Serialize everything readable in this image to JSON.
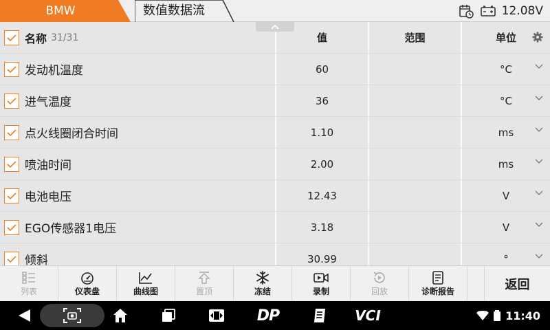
{
  "header": {
    "brand_tab": "BMW",
    "page_tab": "数值数据流",
    "voltage": "12.08V",
    "icons": [
      "calendar-clock-icon",
      "battery-icon"
    ]
  },
  "table": {
    "columns": {
      "name": "名称",
      "count": "31/31",
      "value": "值",
      "range": "范围",
      "unit": "单位"
    },
    "rows": [
      {
        "name": "发动机温度",
        "value": "60",
        "range": "",
        "unit": "°C"
      },
      {
        "name": "进气温度",
        "value": "36",
        "range": "",
        "unit": "°C"
      },
      {
        "name": "点火线圈闭合时间",
        "value": "1.10",
        "range": "",
        "unit": "ms"
      },
      {
        "name": "喷油时间",
        "value": "2.00",
        "range": "",
        "unit": "ms"
      },
      {
        "name": "电池电压",
        "value": "12.43",
        "range": "",
        "unit": "V"
      },
      {
        "name": "EGO传感器1电压",
        "value": "3.18",
        "range": "",
        "unit": "V"
      },
      {
        "name": "倾斜",
        "value": "30.99",
        "range": "",
        "unit": "°"
      }
    ]
  },
  "toolbar": {
    "list": "列表",
    "gauge": "仪表盘",
    "graph": "曲线图",
    "pin_top": "置顶",
    "freeze": "冻结",
    "record": "录制",
    "playback": "回放",
    "report": "诊断报告",
    "back": "返回"
  },
  "navbar": {
    "time": "11:40",
    "brand_dp": "DP",
    "brand_vci": "VCI"
  },
  "colors": {
    "accent": "#f07b22",
    "header_bg": "#efefef",
    "table_cell": "#e6e6e6",
    "navbar": "#000000"
  }
}
